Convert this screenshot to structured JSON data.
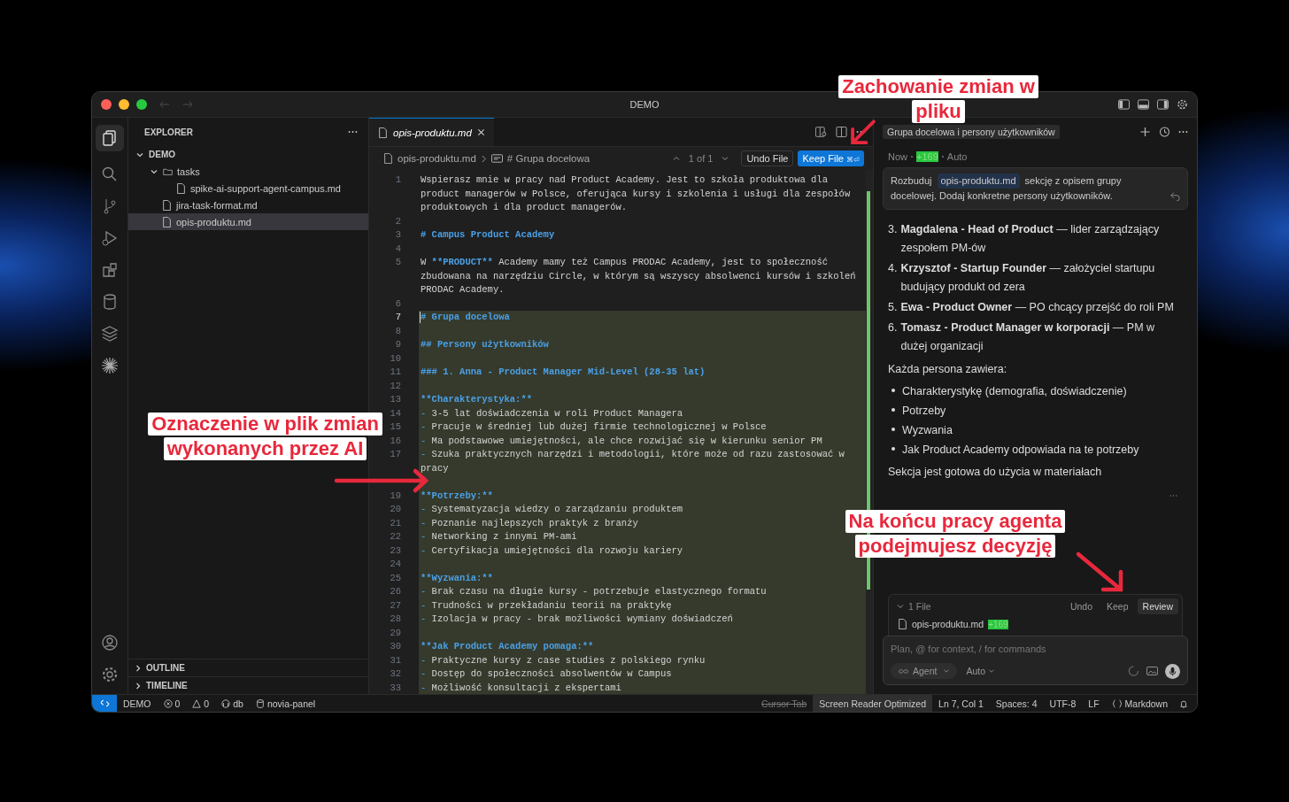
{
  "window": {
    "title": "DEMO"
  },
  "explorer": {
    "title": "EXPLORER",
    "tree": [
      {
        "label": "DEMO",
        "kind": "root",
        "expanded": true,
        "selected": false,
        "children": [
          {
            "label": "tasks",
            "kind": "folder",
            "expanded": true,
            "selected": false,
            "children": [
              {
                "label": "spike-ai-support-agent-campus.md",
                "kind": "file",
                "selected": false
              }
            ]
          },
          {
            "label": "jira-task-format.md",
            "kind": "file",
            "selected": false
          },
          {
            "label": "opis-produktu.md",
            "kind": "file",
            "selected": true
          }
        ]
      }
    ],
    "sections": [
      {
        "label": "OUTLINE",
        "expanded": false
      },
      {
        "label": "TIMELINE",
        "expanded": false
      }
    ]
  },
  "editor": {
    "tab": {
      "label": "opis-produktu.md",
      "selected": true
    },
    "breadcrumb": {
      "file": "opis-produktu.md",
      "symbol": "# Grupa docelowa"
    },
    "change_nav": "1 of 1",
    "undo_button": "Undo File",
    "keep_button": {
      "label": "Keep File",
      "shortcut": "⌘⏎"
    },
    "lines": [
      {
        "n": "1",
        "changed": false,
        "current": false,
        "parts": [
          {
            "kind": "plain",
            "text": "Wspierasz mnie w pracy nad Product Academy. Jest to szkoła produktowa dla product managerów w Polsce, oferująca kursy i szkolenia i usługi dla zespołów produktowych i dla product managerów."
          }
        ]
      },
      {
        "n": "2",
        "changed": false,
        "current": false
      },
      {
        "n": "3",
        "changed": false,
        "current": false,
        "parts": [
          {
            "kind": "heading",
            "text": "# Campus Product Academy"
          }
        ]
      },
      {
        "n": "4",
        "changed": false,
        "current": false
      },
      {
        "n": "5",
        "changed": false,
        "current": false,
        "parts": [
          {
            "kind": "plain",
            "text": "W "
          },
          {
            "kind": "heading",
            "text": "**PRODUCT**"
          },
          {
            "kind": "plain",
            "text": " Academy mamy też Campus PRODAC Academy, jest to społeczność zbudowana na narzędziu Circle, w którym są wszyscy absolwenci kursów i szkoleń PRODAC Academy."
          }
        ]
      },
      {
        "n": "6",
        "changed": false,
        "current": false
      },
      {
        "n": "7",
        "changed": true,
        "current": true,
        "parts": [
          {
            "kind": "heading",
            "text": "# Grupa docelowa"
          }
        ]
      },
      {
        "n": "8",
        "changed": true,
        "current": false
      },
      {
        "n": "9",
        "changed": true,
        "current": false,
        "parts": [
          {
            "kind": "heading",
            "text": "## Persony użytkowników"
          }
        ]
      },
      {
        "n": "10",
        "changed": true,
        "current": false
      },
      {
        "n": "11",
        "changed": true,
        "current": false,
        "parts": [
          {
            "kind": "heading",
            "text": "### 1. Anna - Product Manager Mid-Level (28-35 lat)"
          }
        ]
      },
      {
        "n": "12",
        "changed": true,
        "current": false
      },
      {
        "n": "13",
        "changed": true,
        "current": false,
        "parts": [
          {
            "kind": "heading",
            "text": "**Charakterystyka:**"
          }
        ]
      },
      {
        "n": "14",
        "changed": true,
        "current": false,
        "parts": [
          {
            "kind": "marker",
            "text": "- "
          },
          {
            "kind": "plain",
            "text": "3-5 lat doświadczenia w roli Product Managera"
          }
        ]
      },
      {
        "n": "15",
        "changed": true,
        "current": false,
        "parts": [
          {
            "kind": "marker",
            "text": "- "
          },
          {
            "kind": "plain",
            "text": "Pracuje w średniej lub dużej firmie technologicznej w Polsce"
          }
        ]
      },
      {
        "n": "16",
        "changed": true,
        "current": false,
        "parts": [
          {
            "kind": "marker",
            "text": "- "
          },
          {
            "kind": "plain",
            "text": "Ma podstawowe umiejętności, ale chce rozwijać się w kierunku senior PM"
          }
        ]
      },
      {
        "n": "17",
        "changed": true,
        "current": false,
        "parts": [
          {
            "kind": "marker",
            "text": "- "
          },
          {
            "kind": "plain",
            "text": "Szuka praktycznych narzędzi i metodologii, które może od razu zastosować w pracy"
          }
        ]
      },
      {
        "changed": true,
        "current": false
      },
      {
        "n": "19",
        "changed": true,
        "current": false,
        "parts": [
          {
            "kind": "heading",
            "text": "**Potrzeby:**"
          }
        ]
      },
      {
        "n": "20",
        "changed": true,
        "current": false,
        "parts": [
          {
            "kind": "marker",
            "text": "- "
          },
          {
            "kind": "plain",
            "text": "Systematyzacja wiedzy o zarządzaniu produktem"
          }
        ]
      },
      {
        "n": "21",
        "changed": true,
        "current": false,
        "parts": [
          {
            "kind": "marker",
            "text": "- "
          },
          {
            "kind": "plain",
            "text": "Poznanie najlepszych praktyk z branży"
          }
        ]
      },
      {
        "n": "22",
        "changed": true,
        "current": false,
        "parts": [
          {
            "kind": "marker",
            "text": "- "
          },
          {
            "kind": "plain",
            "text": "Networking z innymi PM-ami"
          }
        ]
      },
      {
        "n": "23",
        "changed": true,
        "current": false,
        "parts": [
          {
            "kind": "marker",
            "text": "- "
          },
          {
            "kind": "plain",
            "text": "Certyfikacja umiejętności dla rozwoju kariery"
          }
        ]
      },
      {
        "n": "24",
        "changed": true,
        "current": false
      },
      {
        "n": "25",
        "changed": true,
        "current": false,
        "parts": [
          {
            "kind": "heading",
            "text": "**Wyzwania:**"
          }
        ]
      },
      {
        "n": "26",
        "changed": true,
        "current": false,
        "parts": [
          {
            "kind": "marker",
            "text": "- "
          },
          {
            "kind": "plain",
            "text": "Brak czasu na długie kursy - potrzebuje elastycznego formatu"
          }
        ]
      },
      {
        "n": "27",
        "changed": true,
        "current": false,
        "parts": [
          {
            "kind": "marker",
            "text": "- "
          },
          {
            "kind": "plain",
            "text": "Trudności w przekładaniu teorii na praktykę"
          }
        ]
      },
      {
        "n": "28",
        "changed": true,
        "current": false,
        "parts": [
          {
            "kind": "marker",
            "text": "- "
          },
          {
            "kind": "plain",
            "text": "Izolacja w pracy - brak możliwości wymiany doświadczeń"
          }
        ]
      },
      {
        "n": "29",
        "changed": true,
        "current": false
      },
      {
        "n": "30",
        "changed": true,
        "current": false,
        "parts": [
          {
            "kind": "heading",
            "text": "**Jak Product Academy pomaga:**"
          }
        ]
      },
      {
        "n": "31",
        "changed": true,
        "current": false,
        "parts": [
          {
            "kind": "marker",
            "text": "- "
          },
          {
            "kind": "plain",
            "text": "Praktyczne kursy z case studies z polskiego rynku"
          }
        ]
      },
      {
        "n": "32",
        "changed": true,
        "current": false,
        "parts": [
          {
            "kind": "marker",
            "text": "- "
          },
          {
            "kind": "plain",
            "text": "Dostęp do społeczności absolwentów w Campus"
          }
        ]
      },
      {
        "n": "33",
        "changed": true,
        "current": false,
        "parts": [
          {
            "kind": "marker",
            "text": "- "
          },
          {
            "kind": "plain",
            "text": "Możliwość konsultacji z ekspertami"
          }
        ]
      }
    ]
  },
  "chat": {
    "tab": "Grupa docelowa i persony użytkowników",
    "meta": {
      "time": "Now",
      "added": "+169",
      "model": "Auto"
    },
    "prompt": {
      "before": "Rozbuduj",
      "file": "opis-produktu.md",
      "after": "sekcję z opisem grupy docelowej. Dodaj konkretne persony użytkowników."
    },
    "numbered": [
      {
        "number": "3.",
        "title": "Magdalena - Head of Product",
        "text": "— lider zarządzający zespołem PM-ów"
      },
      {
        "number": "4.",
        "title": "Krzysztof - Startup Founder",
        "text": "— założyciel startupu budujący produkt od zera"
      },
      {
        "number": "5.",
        "title": "Ewa - Product Owner",
        "text": "— PO chcący przejść do roli PM"
      },
      {
        "number": "6.",
        "title": "Tomasz - Product Manager w korporacji",
        "text": "— PM w dużej organizacji"
      }
    ],
    "intro": "Każda persona zawiera:",
    "bullets": [
      "Charakterystykę (demografia, doświadczenie)",
      "Potrzeby",
      "Wyzwania",
      "Jak Product Academy odpowiada na te potrzeby"
    ],
    "closing": "Sekcja jest gotowa do użycia w materiałach",
    "files": {
      "count": "1 File",
      "expanded": true,
      "undo": "Undo",
      "keep": "Keep",
      "review": "Review",
      "items": [
        {
          "name": "opis-produktu.md",
          "added": "+169"
        }
      ]
    },
    "composer": {
      "placeholder": "Plan, @ for context, / for commands",
      "mode": "Agent",
      "model": "Auto"
    }
  },
  "status_bar": {
    "left": [
      {
        "kind": "remote"
      },
      {
        "kind": "plain",
        "text": "DEMO"
      },
      {
        "kind": "errors",
        "text": "0"
      },
      {
        "kind": "warnings",
        "text": "0"
      },
      {
        "kind": "db",
        "text": "db"
      },
      {
        "kind": "repo",
        "text": "novia-panel"
      }
    ],
    "right": [
      {
        "kind": "disabled",
        "text": "Cursor Tab"
      },
      {
        "kind": "highlight",
        "text": "Screen Reader Optimized"
      },
      {
        "kind": "plain",
        "text": "Ln 7, Col 1"
      },
      {
        "kind": "plain",
        "text": "Spaces: 4"
      },
      {
        "kind": "plain",
        "text": "UTF-8"
      },
      {
        "kind": "plain",
        "text": "LF"
      },
      {
        "kind": "braces",
        "text": "Markdown"
      },
      {
        "kind": "bell"
      }
    ]
  },
  "annotations": [
    {
      "lines": [
        "Zachowanie zmian w",
        "pliku"
      ]
    },
    {
      "lines": [
        "Oznaczenie w plik zmian",
        "wykonanych przez AI"
      ]
    },
    {
      "lines": [
        "Na końcu pracy agenta",
        "podejmujesz decyzję"
      ]
    }
  ]
}
